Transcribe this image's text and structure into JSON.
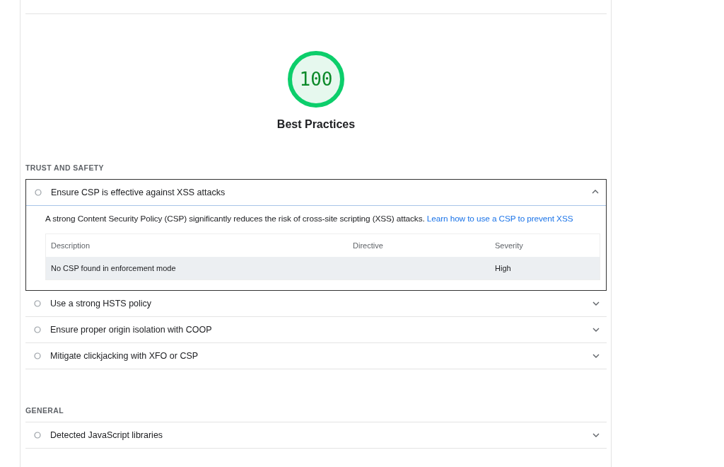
{
  "category": {
    "score": "100",
    "level": 1,
    "title": "Best Practices"
  },
  "groups": [
    {
      "title": "TRUST AND SAFETY",
      "audits": [
        {
          "title": "Ensure CSP is effective against XSS attacks",
          "expanded": true,
          "description": "A strong Content Security Policy (CSP) significantly reduces the risk of cross-site scripting (XSS) attacks.",
          "link": "Learn how to use a CSP to prevent XSS",
          "table": {
            "columns": [
              "Description",
              "Directive",
              "Severity"
            ],
            "rows": [
              [
                "No CSP found in enforcement mode",
                "",
                "High"
              ]
            ]
          }
        },
        {
          "title": "Use a strong HSTS policy",
          "expanded": false
        },
        {
          "title": "Ensure proper origin isolation with COOP",
          "expanded": false
        },
        {
          "title": "Mitigate clickjacking with XFO or CSP",
          "expanded": false
        }
      ]
    },
    {
      "title": "GENERAL",
      "audits": [
        {
          "title": "Detected JavaScript libraries",
          "expanded": false
        }
      ]
    }
  ]
}
